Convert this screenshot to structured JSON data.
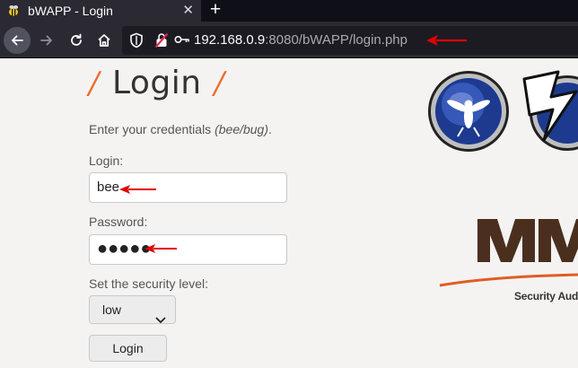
{
  "browser": {
    "tab": {
      "title": "bWAPP - Login",
      "close_glyph": "✕",
      "favicon": "bee-favicon-icon"
    },
    "new_tab_glyph": "+",
    "url": {
      "host": "192.168.0.9",
      "rest": ":8080/bWAPP/login.php"
    },
    "icons": [
      "back-arrow-icon",
      "forward-arrow-icon",
      "reload-icon",
      "home-icon",
      "shield-icon",
      "insecure-lock-icon",
      "key-icon"
    ]
  },
  "page": {
    "title": "Login",
    "slash": "/",
    "intro_text": "Enter your credentials ",
    "intro_hint": "(bee/bug)",
    "intro_end": ".",
    "login_label": "Login:",
    "login_value": "bee",
    "password_label": "Password:",
    "password_value": "●●●●●",
    "security_label": "Set the security level:",
    "security_value": "low",
    "login_button": "Login"
  },
  "logos": {
    "mme_caption": "Security Aud"
  },
  "colors": {
    "annotation_arrow": "#e00000",
    "accent_orange": "#ec6b2b"
  }
}
